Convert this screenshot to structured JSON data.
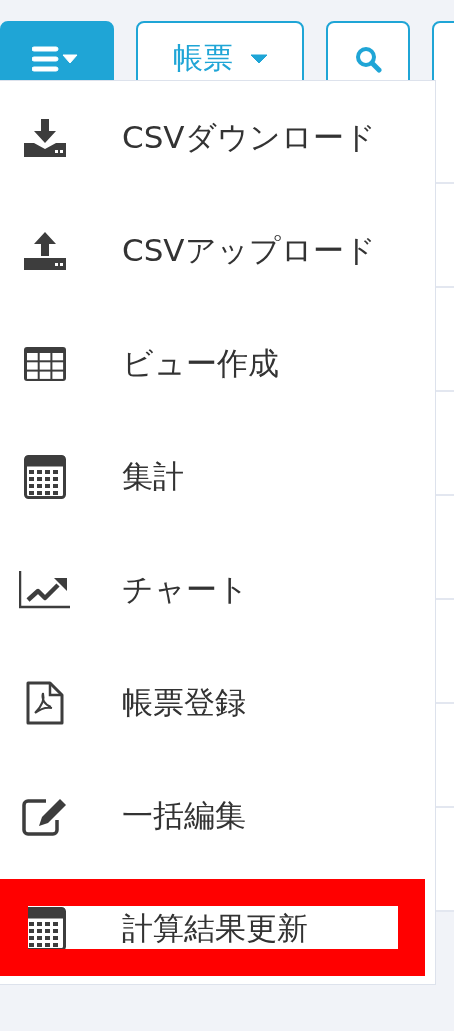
{
  "toolbar": {
    "buttons": [
      {
        "kind": "menu",
        "active": true
      },
      {
        "kind": "dropdown",
        "label": "帳票",
        "active": false
      },
      {
        "kind": "search",
        "active": false
      },
      {
        "kind": "blank",
        "active": false
      }
    ]
  },
  "menu": {
    "items": [
      {
        "kind": "download",
        "label": "CSVダウンロード",
        "highlighted": false
      },
      {
        "kind": "upload",
        "label": "CSVアップロード",
        "highlighted": false
      },
      {
        "kind": "table",
        "label": "ビュー作成",
        "highlighted": false
      },
      {
        "kind": "calculator",
        "label": "集計",
        "highlighted": false
      },
      {
        "kind": "chart",
        "label": "チャート",
        "highlighted": false
      },
      {
        "kind": "pdf",
        "label": "帳票登録",
        "highlighted": false
      },
      {
        "kind": "edit",
        "label": "一括編集",
        "highlighted": false
      },
      {
        "kind": "calculator",
        "label": "計算結果更新",
        "highlighted": true
      }
    ]
  }
}
